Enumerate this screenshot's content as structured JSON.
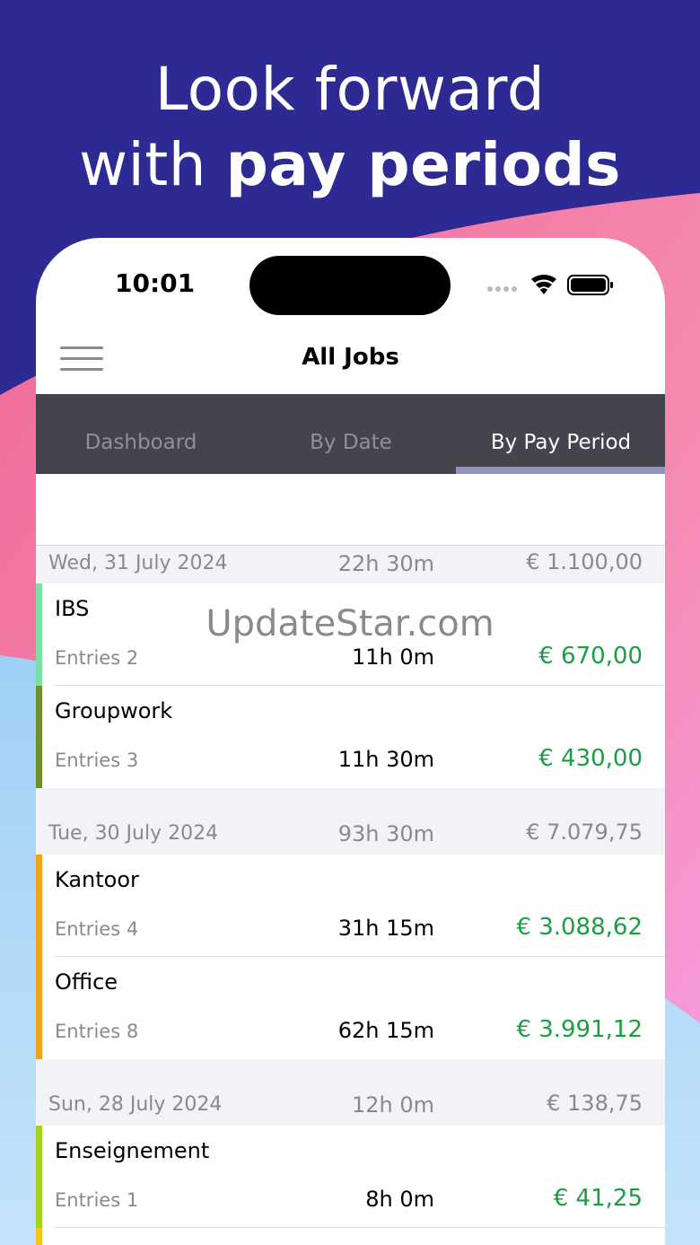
{
  "headline": {
    "line1": "Look forward",
    "line2_prefix": "with ",
    "line2_bold": "pay periods"
  },
  "watermark": "UpdateStar.com",
  "status_bar": {
    "time": "10:01"
  },
  "nav": {
    "title": "All Jobs",
    "menu_icon": "hamburger-menu-icon"
  },
  "tabs": [
    {
      "label": "Dashboard",
      "active": false
    },
    {
      "label": "By Date",
      "active": false
    },
    {
      "label": "By Pay Period",
      "active": true
    }
  ],
  "sections": [
    {
      "date": "Wed, 31 July 2024",
      "hours": "22h 30m",
      "amount": "€ 1.100,00",
      "rows": [
        {
          "name": "IBS",
          "entries": "Entries 2",
          "hours": "11h 0m",
          "amount": "€ 670,00",
          "color": "#7de0a2"
        },
        {
          "name": "Groupwork",
          "entries": "Entries 3",
          "hours": "11h 30m",
          "amount": "€ 430,00",
          "color": "#6f8f2a"
        }
      ]
    },
    {
      "date": "Tue, 30 July 2024",
      "hours": "93h 30m",
      "amount": "€ 7.079,75",
      "rows": [
        {
          "name": "Kantoor",
          "entries": "Entries 4",
          "hours": "31h 15m",
          "amount": "€ 3.088,62",
          "color": "#f5a21b"
        },
        {
          "name": "Office",
          "entries": "Entries 8",
          "hours": "62h 15m",
          "amount": "€ 3.991,12",
          "color": "#f5a21b"
        }
      ]
    },
    {
      "date": "Sun, 28 July 2024",
      "hours": "12h 0m",
      "amount": "€ 138,75",
      "rows": [
        {
          "name": "Enseignement",
          "entries": "Entries 1",
          "hours": "8h 0m",
          "amount": "€ 41,25",
          "color": "#a5d21e"
        }
      ]
    }
  ],
  "colors": {
    "background": "#2e2a93",
    "tab_bar": "#45434e",
    "amount_green": "#1b9e43",
    "pink_wave": "#f58ab0",
    "blue_wave": "#a9d4f6"
  }
}
